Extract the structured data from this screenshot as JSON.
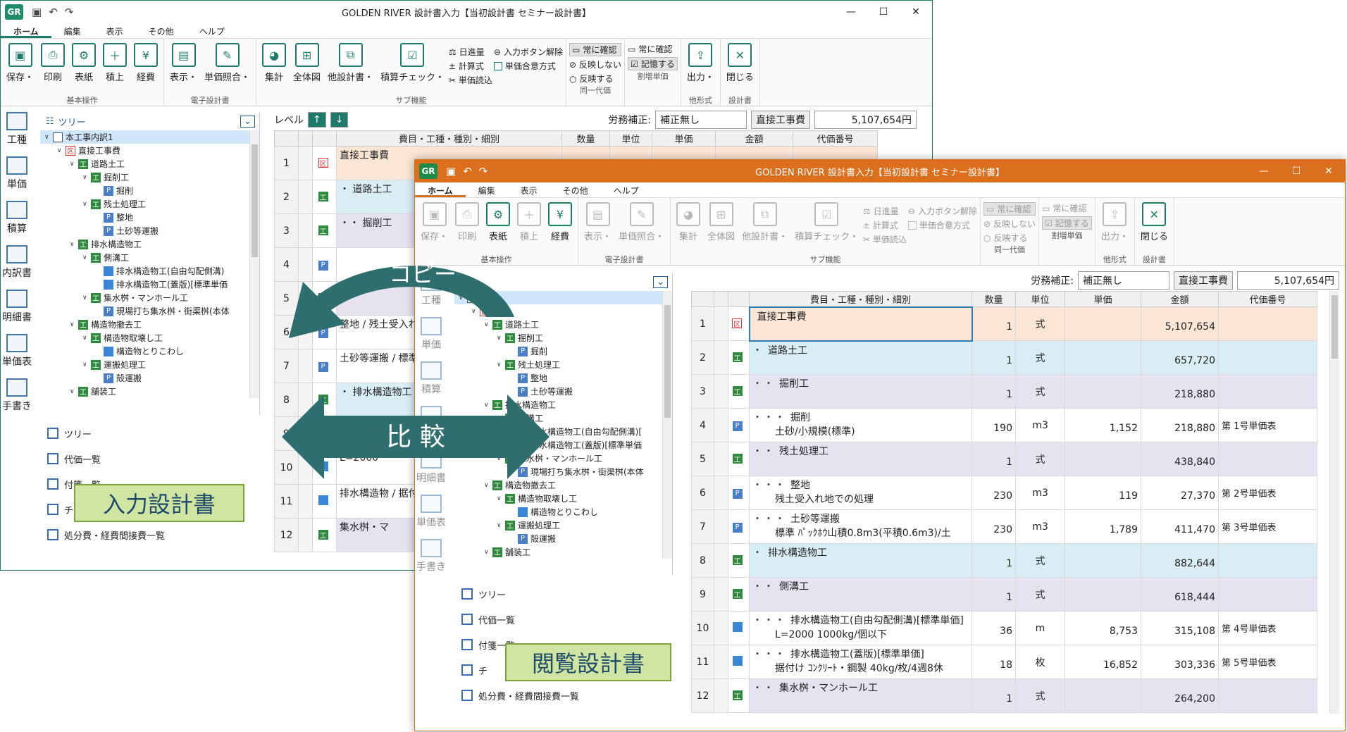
{
  "back_window": {
    "title": "GOLDEN RIVER 設計書入力【当初設計書 セミナー設計書】",
    "menu": [
      "ホーム",
      "編集",
      "表示",
      "その他",
      "ヘルプ"
    ],
    "ribbon": {
      "basic": {
        "label": "基本操作",
        "buttons": [
          "保存・",
          "印刷",
          "表紙",
          "積上",
          "経費"
        ]
      },
      "electronic": {
        "label": "電子設計書",
        "buttons": [
          "表示・",
          "単価照合・"
        ]
      },
      "sub": {
        "label": "サブ機能",
        "buttons": [
          "集計",
          "全体図",
          "他設計書・",
          "積算チェック・"
        ],
        "small": [
          "日進量",
          "計算式",
          "単価読込"
        ],
        "small2": [
          "入力ボタン解除",
          "単価合意方式"
        ]
      },
      "same": {
        "label": "同一代価",
        "items": [
          "常に確認",
          "反映しない",
          "反映する"
        ]
      },
      "ratio": {
        "label": "割増単価",
        "items": [
          "常に確認",
          "記憶する"
        ]
      },
      "other": {
        "label": "他形式",
        "buttons": [
          "出力・"
        ]
      },
      "design": {
        "label": "設計書",
        "buttons": [
          "閉じる"
        ]
      }
    },
    "rail": [
      "工種",
      "単価",
      "積算",
      "内訳書",
      "明細書",
      "単価表",
      "手書き"
    ],
    "tree_title": "ツリー",
    "tree": [
      {
        "t": "F",
        "label": "本工事内訳1",
        "lvl": 0
      },
      {
        "t": "X",
        "label": "直接工事費",
        "lvl": 1
      },
      {
        "t": "T",
        "label": "道路土工",
        "lvl": 2
      },
      {
        "t": "T",
        "label": "掘削工",
        "lvl": 3
      },
      {
        "t": "P",
        "label": "掘削",
        "lvl": 4
      },
      {
        "t": "T",
        "label": "残土処理工",
        "lvl": 3
      },
      {
        "t": "P",
        "label": "整地",
        "lvl": 4
      },
      {
        "t": "P",
        "label": "土砂等運搬",
        "lvl": 4
      },
      {
        "t": "T",
        "label": "排水構造物工",
        "lvl": 2
      },
      {
        "t": "T",
        "label": "側溝工",
        "lvl": 3
      },
      {
        "t": "S",
        "label": "排水構造物工(自由勾配側溝)",
        "lvl": 4
      },
      {
        "t": "S",
        "label": "排水構造物工(蓋版)[標準単価",
        "lvl": 4
      },
      {
        "t": "T",
        "label": "集水桝・マンホール工",
        "lvl": 3
      },
      {
        "t": "P",
        "label": "現場打ち集水桝・街渠桝(本体",
        "lvl": 4
      },
      {
        "t": "T",
        "label": "構造物撤去工",
        "lvl": 2
      },
      {
        "t": "T",
        "label": "構造物取壊し工",
        "lvl": 3
      },
      {
        "t": "S",
        "label": "構造物とりこわし",
        "lvl": 4
      },
      {
        "t": "T",
        "label": "運搬処理工",
        "lvl": 3
      },
      {
        "t": "P",
        "label": "殻運搬",
        "lvl": 4
      },
      {
        "t": "T",
        "label": "舗装工",
        "lvl": 2
      }
    ],
    "bottom_list": [
      "ツリー",
      "代価一覧",
      "付箋一覧",
      "チ",
      "処分費・経費間接費一覧"
    ],
    "badge": "入力設計書",
    "level_label": "レベル",
    "labor_label": "労務補正:",
    "labor_value": "補正無し",
    "direct_label": "直接工事費",
    "direct_value": "5,107,654円",
    "headers": [
      "費目・工種・種別・細別",
      "数量",
      "単位",
      "単価",
      "金額",
      "代価番号"
    ],
    "rows": [
      {
        "n": "1",
        "t": "X",
        "name": "直接工事費",
        "bg": "o"
      },
      {
        "n": "2",
        "t": "T",
        "name": "・ 道路土工",
        "bg": "b"
      },
      {
        "n": "3",
        "t": "T",
        "name": "・・ 掘削工",
        "bg": "v"
      },
      {
        "n": "4",
        "t": "P",
        "name": "",
        "bg": "w"
      },
      {
        "n": "5",
        "t": "T",
        "name": "",
        "bg": "v"
      },
      {
        "n": "6",
        "t": "P",
        "name": "整地 / 残土受入れ",
        "bg": "w"
      },
      {
        "n": "7",
        "t": "P",
        "name": "土砂等運搬 / 標準 ﾊﾟｯｸ",
        "bg": "w"
      },
      {
        "n": "8",
        "t": "T",
        "name": "・ 排水構造物工",
        "bg": "b"
      },
      {
        "n": "9",
        "t": "T",
        "name": "",
        "bg": "v"
      },
      {
        "n": "10",
        "t": "S",
        "name": "L=2000",
        "bg": "w"
      },
      {
        "n": "11",
        "t": "S",
        "name": "排水構造物 / 据付け",
        "bg": "w"
      },
      {
        "n": "12",
        "t": "T",
        "name": "集水桝・マ",
        "bg": "v"
      }
    ]
  },
  "front_window": {
    "title": "GOLDEN RIVER 設計書入力【当初設計書 セミナー設計書】",
    "menu": [
      "ホーム",
      "編集",
      "表示",
      "その他",
      "ヘルプ"
    ],
    "ribbon": {
      "basic": {
        "label": "基本操作",
        "buttons": [
          "保存・",
          "印刷",
          "表紙",
          "積上",
          "経費"
        ]
      },
      "electronic": {
        "label": "電子設計書",
        "buttons": [
          "表示・",
          "単価照合・"
        ]
      },
      "sub": {
        "label": "サブ機能",
        "buttons": [
          "集計",
          "全体図",
          "他設計書・",
          "積算チェック・"
        ],
        "small": [
          "日進量",
          "計算式",
          "単価読込"
        ],
        "small2": [
          "入力ボタン解除",
          "単価合意方式"
        ]
      },
      "same": {
        "label": "同一代価",
        "items": [
          "常に確認",
          "反映しない",
          "反映する"
        ]
      },
      "ratio": {
        "label": "割増単価",
        "items": [
          "常に確認",
          "記憶する"
        ]
      },
      "other": {
        "label": "他形式",
        "buttons": [
          "出力・"
        ]
      },
      "design": {
        "label": "設計書",
        "buttons": [
          "閉じる"
        ]
      }
    },
    "rail": [
      "工種",
      "単価",
      "積算",
      "内訳書",
      "明細書",
      "単価表",
      "手書き"
    ],
    "tree": [
      {
        "t": "F",
        "label": "訳1",
        "lvl": 0
      },
      {
        "t": "X",
        "label": "事費",
        "lvl": 1
      },
      {
        "t": "T",
        "label": "道路土工",
        "lvl": 2
      },
      {
        "t": "T",
        "label": "掘削工",
        "lvl": 3
      },
      {
        "t": "P",
        "label": "掘削",
        "lvl": 4
      },
      {
        "t": "T",
        "label": "残土処理工",
        "lvl": 3
      },
      {
        "t": "P",
        "label": "整地",
        "lvl": 4
      },
      {
        "t": "P",
        "label": "土砂等運搬",
        "lvl": 4
      },
      {
        "t": "T",
        "label": "排水構造物工",
        "lvl": 2
      },
      {
        "t": "T",
        "label": "側溝工",
        "lvl": 3
      },
      {
        "t": "S",
        "label": "排水構造物工(自由勾配側溝)[",
        "lvl": 4
      },
      {
        "t": "S",
        "label": "排水構造物工(蓋版)[標準単価",
        "lvl": 4
      },
      {
        "t": "T",
        "label": "集水桝・マンホール工",
        "lvl": 3
      },
      {
        "t": "P",
        "label": "現場打ち集水桝・街渠桝(本体",
        "lvl": 4
      },
      {
        "t": "T",
        "label": "構造物撤去工",
        "lvl": 2
      },
      {
        "t": "T",
        "label": "構造物取壊し工",
        "lvl": 3
      },
      {
        "t": "S",
        "label": "構造物とりこわし",
        "lvl": 4
      },
      {
        "t": "T",
        "label": "運搬処理工",
        "lvl": 3
      },
      {
        "t": "P",
        "label": "殻運搬",
        "lvl": 4
      },
      {
        "t": "T",
        "label": "舗装工",
        "lvl": 2
      }
    ],
    "bottom_list": [
      "ツリー",
      "代価一覧",
      "付箋一覧",
      "チ",
      "処分費・経費間接費一覧"
    ],
    "badge": "閲覧設計書",
    "labor_label": "労務補正:",
    "labor_value": "補正無し",
    "direct_label": "直接工事費",
    "direct_value": "5,107,654円",
    "headers": [
      "費目・工種・種別・細別",
      "数量",
      "単位",
      "単価",
      "金額",
      "代価番号"
    ],
    "rows": [
      {
        "n": "1",
        "t": "X",
        "dots": "",
        "name": "直接工事費",
        "sub": "",
        "qty": "1",
        "unit": "式",
        "price": "",
        "amount": "5,107,654",
        "code": "",
        "bg": "o"
      },
      {
        "n": "2",
        "t": "T",
        "dots": "・",
        "name": "道路土工",
        "sub": "",
        "qty": "1",
        "unit": "式",
        "price": "",
        "amount": "657,720",
        "code": "",
        "bg": "b"
      },
      {
        "n": "3",
        "t": "T",
        "dots": "・・",
        "name": "掘削工",
        "sub": "",
        "qty": "1",
        "unit": "式",
        "price": "",
        "amount": "218,880",
        "code": "",
        "bg": "v"
      },
      {
        "n": "4",
        "t": "P",
        "dots": "・・・",
        "name": "掘削",
        "sub": "土砂/小規模(標準)",
        "qty": "190",
        "unit": "m3",
        "price": "1,152",
        "amount": "218,880",
        "code": "第 1号単価表",
        "bg": "w"
      },
      {
        "n": "5",
        "t": "T",
        "dots": "・・",
        "name": "残土処理工",
        "sub": "",
        "qty": "1",
        "unit": "式",
        "price": "",
        "amount": "438,840",
        "code": "",
        "bg": "v"
      },
      {
        "n": "6",
        "t": "P",
        "dots": "・・・",
        "name": "整地",
        "sub": "残土受入れ地での処理",
        "qty": "230",
        "unit": "m3",
        "price": "119",
        "amount": "27,370",
        "code": "第 2号単価表",
        "bg": "w"
      },
      {
        "n": "7",
        "t": "P",
        "dots": "・・・",
        "name": "土砂等運搬",
        "sub": "標準 ﾊﾟｯｸﾎｳ山積0.8m3(平積0.6m3)/土",
        "qty": "230",
        "unit": "m3",
        "price": "1,789",
        "amount": "411,470",
        "code": "第 3号単価表",
        "bg": "w"
      },
      {
        "n": "8",
        "t": "T",
        "dots": "・",
        "name": "排水構造物工",
        "sub": "",
        "qty": "1",
        "unit": "式",
        "price": "",
        "amount": "882,644",
        "code": "",
        "bg": "b"
      },
      {
        "n": "9",
        "t": "T",
        "dots": "・・",
        "name": "側溝工",
        "sub": "",
        "qty": "1",
        "unit": "式",
        "price": "",
        "amount": "618,444",
        "code": "",
        "bg": "v"
      },
      {
        "n": "10",
        "t": "S",
        "dots": "・・・",
        "name": "排水構造物工(自由勾配側溝)[標準単価]",
        "sub": "L=2000  1000kg/個以下",
        "qty": "36",
        "unit": "m",
        "price": "8,753",
        "amount": "315,108",
        "code": "第 4号単価表",
        "bg": "w"
      },
      {
        "n": "11",
        "t": "S",
        "dots": "・・・",
        "name": "排水構造物工(蓋版)[標準単価]",
        "sub": "据付け  ｺﾝｸﾘｰﾄ・鋼製 40kg/枚/4週8休",
        "qty": "18",
        "unit": "枚",
        "price": "16,852",
        "amount": "303,336",
        "code": "第 5号単価表",
        "bg": "w"
      },
      {
        "n": "12",
        "t": "T",
        "dots": "・・",
        "name": "集水桝・マンホール工",
        "sub": "",
        "qty": "1",
        "unit": "式",
        "price": "",
        "amount": "264,200",
        "code": "",
        "bg": "v"
      }
    ]
  },
  "overlay": {
    "copy_label": "コピー",
    "compare_label": "比 較"
  },
  "colors": {
    "back_accent": "#1e7b6b",
    "front_accent": "#dc6f1e",
    "arrow": "#2e6e6e",
    "badge_bg": "#cfe5a1"
  }
}
